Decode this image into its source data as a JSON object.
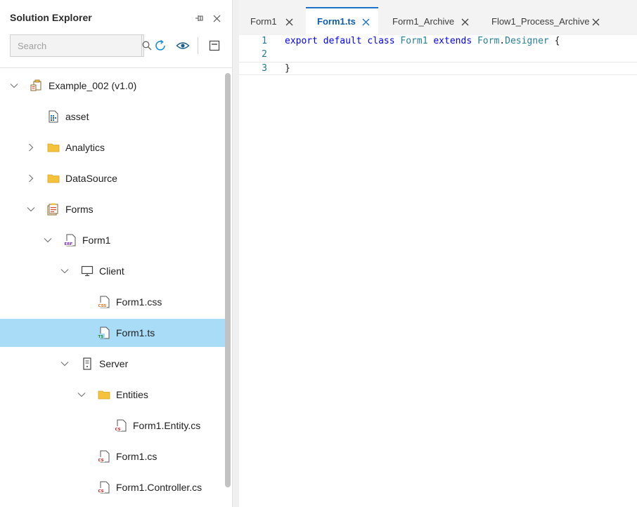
{
  "explorer": {
    "title": "Solution Explorer",
    "search": {
      "placeholder": "Search",
      "value": ""
    },
    "toolbar_icons": [
      "pin-icon",
      "close-icon",
      "search-icon",
      "refresh-icon",
      "eye-icon",
      "collapse-all-icon"
    ]
  },
  "tree": [
    {
      "label": "Example_002 (v1.0)",
      "icon": "solution-icon",
      "state": "expanded"
    },
    {
      "label": "asset",
      "icon": "asset-file-icon",
      "state": "leaf"
    },
    {
      "label": "Analytics",
      "icon": "folder-icon",
      "state": "collapsed"
    },
    {
      "label": "DataSource",
      "icon": "folder-icon",
      "state": "collapsed"
    },
    {
      "label": "Forms",
      "icon": "forms-folder-icon",
      "state": "expanded"
    },
    {
      "label": "Form1",
      "icon": "form-file-icon",
      "badge": "ERF",
      "state": "expanded"
    },
    {
      "label": "Client",
      "icon": "monitor-icon",
      "state": "expanded"
    },
    {
      "label": "Form1.css",
      "icon": "css-file-icon",
      "badge": "CSS",
      "state": "leaf"
    },
    {
      "label": "Form1.ts",
      "icon": "ts-file-icon",
      "badge": "TS",
      "state": "leaf",
      "selected": true
    },
    {
      "label": "Server",
      "icon": "server-icon",
      "state": "expanded"
    },
    {
      "label": "Entities",
      "icon": "folder-icon",
      "state": "expanded"
    },
    {
      "label": "Form1.Entity.cs",
      "icon": "cs-file-icon",
      "badge": "CS",
      "state": "leaf"
    },
    {
      "label": "Form1.cs",
      "icon": "cs-file-icon",
      "badge": "CS",
      "state": "leaf"
    },
    {
      "label": "Form1.Controller.cs",
      "icon": "cs-file-icon",
      "badge": "CS",
      "state": "leaf"
    }
  ],
  "editor": {
    "tabs": [
      {
        "label": "Form1",
        "active": false
      },
      {
        "label": "Form1.ts",
        "active": true
      },
      {
        "label": "Form1_Archive",
        "active": false
      },
      {
        "label": "Flow1_Process_Archive",
        "active": false
      }
    ],
    "lines": [
      {
        "number": "1",
        "tokens": [
          {
            "text": "export",
            "kind": "keyword"
          },
          {
            "text": " ",
            "kind": "plain"
          },
          {
            "text": "default",
            "kind": "keyword"
          },
          {
            "text": " ",
            "kind": "plain"
          },
          {
            "text": "class",
            "kind": "keyword"
          },
          {
            "text": " ",
            "kind": "plain"
          },
          {
            "text": "Form1",
            "kind": "type"
          },
          {
            "text": " ",
            "kind": "plain"
          },
          {
            "text": "extends",
            "kind": "keyword"
          },
          {
            "text": " ",
            "kind": "plain"
          },
          {
            "text": "Form",
            "kind": "type"
          },
          {
            "text": ".",
            "kind": "plain"
          },
          {
            "text": "Designer",
            "kind": "type"
          },
          {
            "text": " {",
            "kind": "plain"
          }
        ]
      },
      {
        "number": "2",
        "tokens": []
      },
      {
        "number": "3",
        "current": true,
        "tokens": [
          {
            "text": "}",
            "kind": "plain"
          }
        ]
      }
    ],
    "colors": {
      "keyword": "#0000ff",
      "type": "#267f99",
      "line_number": "#237893",
      "active_tab": "#1a73c9"
    }
  },
  "colors": {
    "selection": "#a8dcf7",
    "folder": "#f5c33b"
  }
}
